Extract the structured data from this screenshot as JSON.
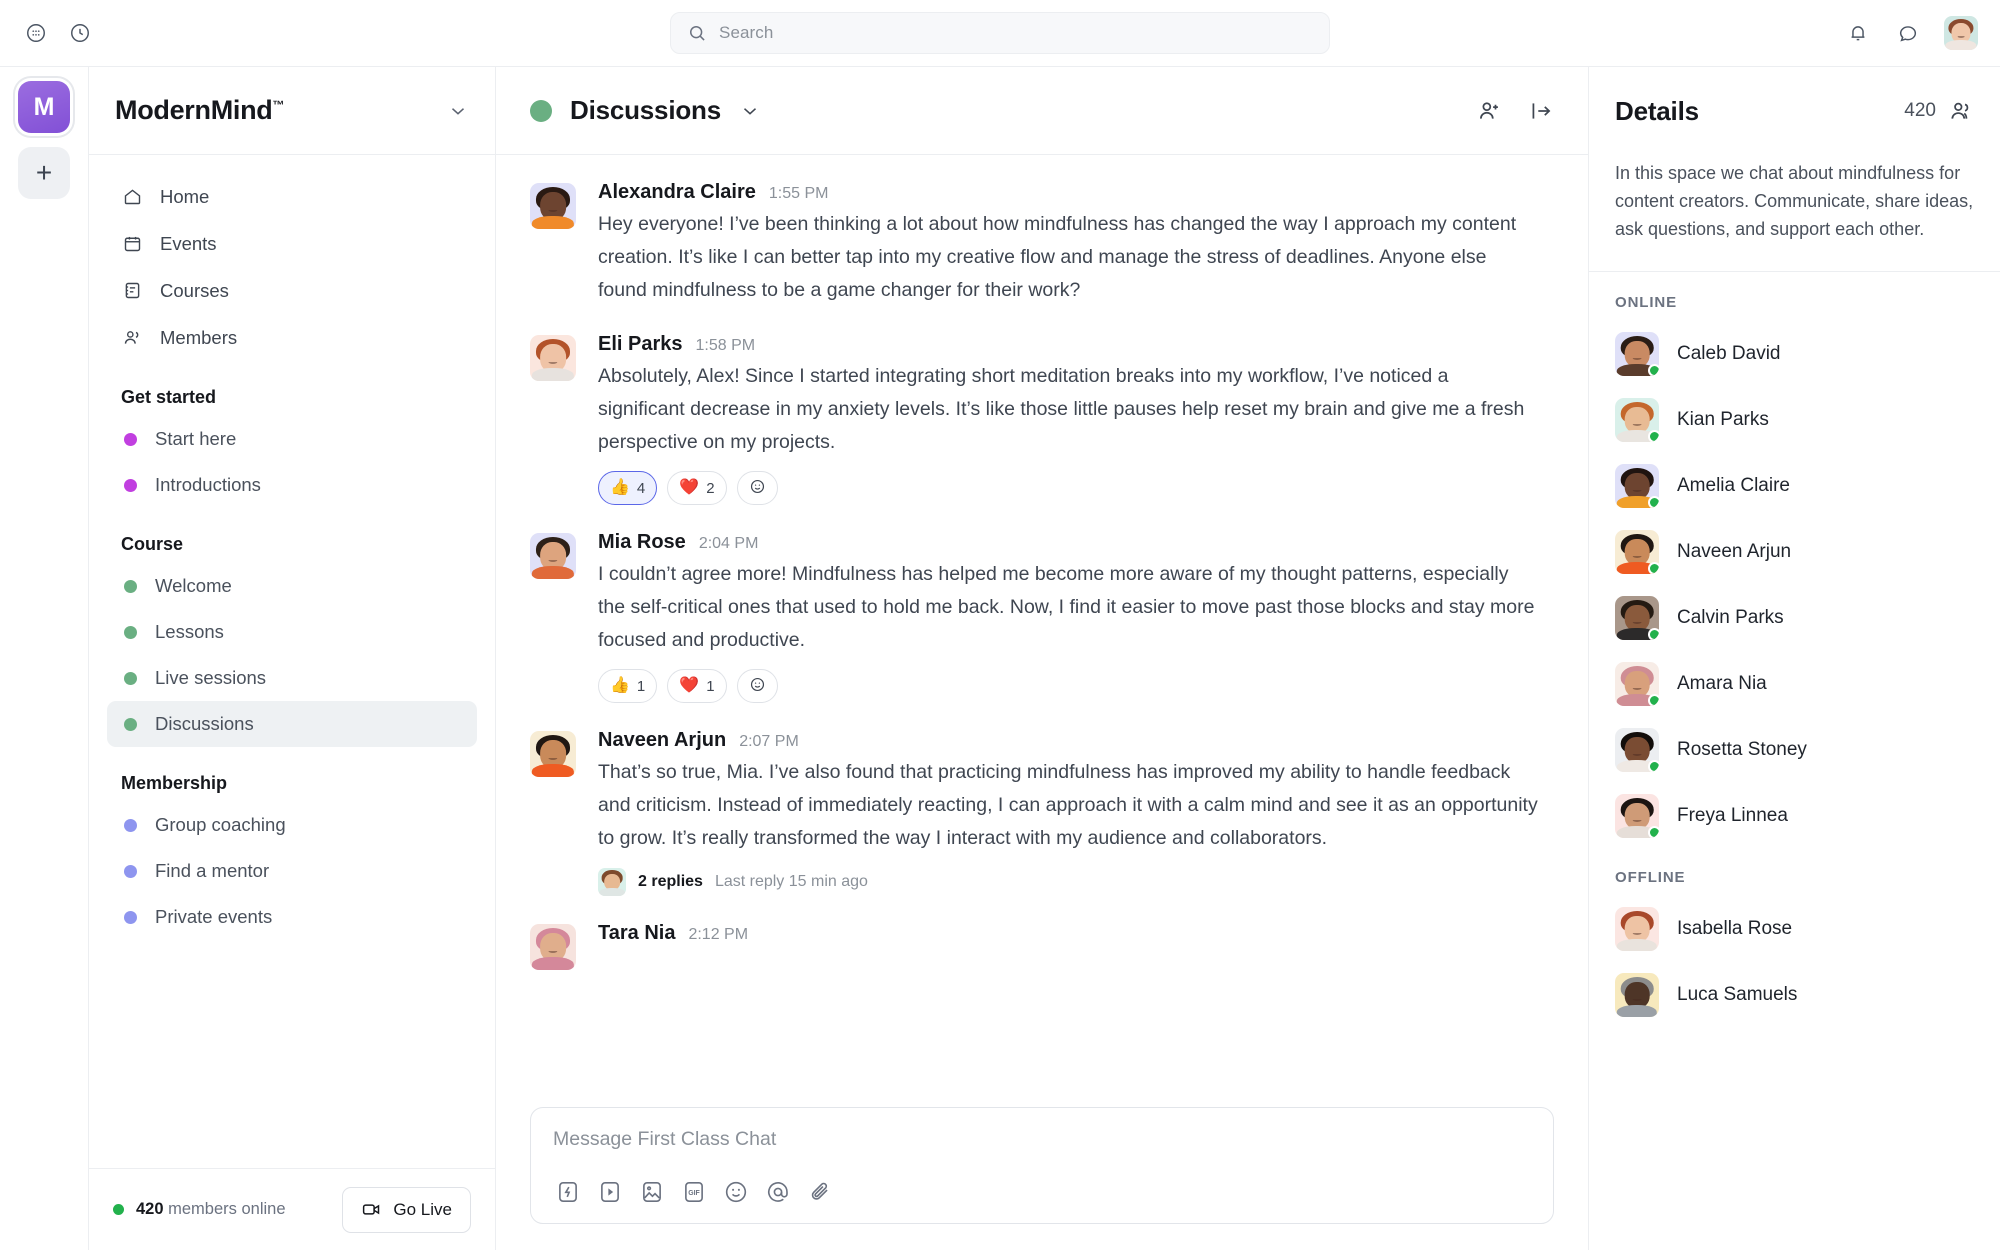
{
  "topbar": {
    "apps_icon": "grid-apps-icon",
    "history_icon": "clock-history-icon",
    "search": {
      "placeholder": "Search",
      "value": "",
      "icon": "search-icon"
    },
    "notifications_icon": "bell-icon",
    "messages_icon": "chat-bubble-icon",
    "account_avatar": "user-avatar"
  },
  "rail": {
    "workspace_initial": "M",
    "add_label": "+"
  },
  "sidebar": {
    "title": "ModernMind",
    "trademark": "™",
    "caret_icon": "chevron-down-icon",
    "nav": [
      {
        "label": "Home",
        "icon": "home-icon"
      },
      {
        "label": "Events",
        "icon": "calendar-icon"
      },
      {
        "label": "Courses",
        "icon": "course-list-icon"
      },
      {
        "label": "Members",
        "icon": "people-icon"
      }
    ],
    "groups": [
      {
        "title": "Get started",
        "items": [
          {
            "label": "Start here",
            "color": "#c13fe0",
            "active": false
          },
          {
            "label": "Introductions",
            "color": "#c13fe0",
            "active": false
          }
        ]
      },
      {
        "title": "Course",
        "items": [
          {
            "label": "Welcome",
            "color": "#6aaf82",
            "active": false
          },
          {
            "label": "Lessons",
            "color": "#6aaf82",
            "active": false
          },
          {
            "label": "Live sessions",
            "color": "#6aaf82",
            "active": false
          },
          {
            "label": "Discussions",
            "color": "#6aaf82",
            "active": true
          }
        ]
      },
      {
        "title": "Membership",
        "items": [
          {
            "label": "Group coaching",
            "color": "#8e95ef",
            "active": false
          },
          {
            "label": "Find a mentor",
            "color": "#8e95ef",
            "active": false
          },
          {
            "label": "Private events",
            "color": "#8e95ef",
            "active": false
          }
        ]
      }
    ],
    "footer": {
      "online_count": "420",
      "online_suffix": "members online",
      "go_live_label": "Go Live",
      "go_live_icon": "video-camera-icon"
    }
  },
  "chat": {
    "header": {
      "channel": "Discussions",
      "status_color": "#6aaf82",
      "caret_icon": "chevron-down-icon",
      "add_member_icon": "add-person-icon",
      "collapse_icon": "panel-collapse-icon"
    },
    "messages": [
      {
        "author": "Alexandra Claire",
        "time": "1:55 PM",
        "text": "Hey everyone! I’ve been thinking a lot about how mindfulness has changed the way I approach my content creation. It’s like I can better tap into my creative flow and manage the stress of deadlines. Anyone else found mindfulness to be a game changer for their work?",
        "avatar_bg": "#dfe0f8",
        "skin": "#6d4430",
        "hair": "#2a1a13",
        "shirt": "#f08a2a",
        "reactions": [],
        "thread": null
      },
      {
        "author": "Eli Parks",
        "time": "1:58 PM",
        "text": "Absolutely, Alex! Since I started integrating short meditation breaks into my workflow, I’ve noticed a significant decrease in my anxiety levels. It’s like those little pauses help reset my brain and give me a fresh perspective on my projects.",
        "avatar_bg": "#fbe6de",
        "skin": "#efc3a6",
        "hair": "#b3532a",
        "shirt": "#e7e2de",
        "reactions": [
          {
            "emoji": "👍",
            "count": "4",
            "selected": true
          },
          {
            "emoji": "❤️",
            "count": "2",
            "selected": false
          },
          {
            "emoji": "☺",
            "count": "",
            "selected": false
          }
        ],
        "thread": null
      },
      {
        "author": "Mia Rose",
        "time": "2:04 PM",
        "text": "I couldn’t agree more! Mindfulness has helped me become more aware of my thought patterns, especially the self-critical ones that used to hold me back. Now, I find it easier to move past those blocks and stay more focused and productive.",
        "avatar_bg": "#dfe0f8",
        "skin": "#dda47e",
        "hair": "#2d2018",
        "shirt": "#e06a3a",
        "reactions": [
          {
            "emoji": "👍",
            "count": "1",
            "selected": false
          },
          {
            "emoji": "❤️",
            "count": "1",
            "selected": false
          },
          {
            "emoji": "☺",
            "count": "",
            "selected": false
          }
        ],
        "thread": null
      },
      {
        "author": "Naveen Arjun",
        "time": "2:07 PM",
        "text": "That’s so true, Mia. I’ve also found that practicing mindfulness has improved my ability to handle feedback and criticism. Instead of immediately reacting, I can approach it with a calm mind and see it as an opportunity to grow. It’s really transformed the way I interact with my audience and collaborators.",
        "avatar_bg": "#f7ecd4",
        "skin": "#c98a5a",
        "hair": "#201712",
        "shirt": "#ef5b22",
        "reactions": [],
        "thread": {
          "count_label": "2 replies",
          "meta": "Last reply 15 min ago",
          "avatar_bg": "#d9f0ea",
          "skin": "#e7b992",
          "hair": "#7d4a2c"
        }
      },
      {
        "author": "Tara Nia",
        "time": "2:12 PM",
        "text": "",
        "avatar_bg": "#f6e3de",
        "skin": "#e0ae8c",
        "hair": "#d4889a",
        "shirt": "#d4889a",
        "reactions": [],
        "thread": null
      }
    ],
    "composer": {
      "placeholder": "Message First Class Chat",
      "value": "",
      "tools": [
        {
          "icon": "lightning-bolt-icon",
          "name": "quick-action"
        },
        {
          "icon": "video-play-icon",
          "name": "video"
        },
        {
          "icon": "image-icon",
          "name": "image"
        },
        {
          "icon": "gif-icon",
          "name": "gif",
          "text": "GIF"
        },
        {
          "icon": "emoji-smiley-icon",
          "name": "emoji"
        },
        {
          "icon": "mention-at-icon",
          "name": "mention"
        },
        {
          "icon": "paperclip-icon",
          "name": "attachment"
        }
      ]
    }
  },
  "details": {
    "title": "Details",
    "member_count": "420",
    "members_icon": "people-icon",
    "description": "In this space we chat about mindfulness for content creators. Communicate, share ideas, ask questions, and support each other.",
    "sections": [
      {
        "label": "ONLINE",
        "members": [
          {
            "name": "Caleb David",
            "avatar_bg": "#dfe0f8",
            "skin": "#c98a63",
            "hair": "#2b1d15",
            "shirt": "#5a3c2c",
            "online": true
          },
          {
            "name": "Kian Parks",
            "avatar_bg": "#d9f0ea",
            "skin": "#e8bb94",
            "hair": "#c4672c",
            "shirt": "#e9e5e0",
            "online": true
          },
          {
            "name": "Amelia Claire",
            "avatar_bg": "#dfe0f8",
            "skin": "#6d4430",
            "hair": "#201410",
            "shirt": "#f0a02a",
            "online": true
          },
          {
            "name": "Naveen Arjun",
            "avatar_bg": "#f7ecd4",
            "skin": "#c98a5a",
            "hair": "#201712",
            "shirt": "#ef5b22",
            "online": true
          },
          {
            "name": "Calvin Parks",
            "avatar_bg": "#a9978a",
            "skin": "#8a5a3c",
            "hair": "#241a12",
            "shirt": "#2c2a2a",
            "online": true
          },
          {
            "name": "Amara Nia",
            "avatar_bg": "#f7ece6",
            "skin": "#d8a07c",
            "hair": "#cf8d94",
            "shirt": "#cf8d94",
            "online": true
          },
          {
            "name": "Rosetta Stoney",
            "avatar_bg": "#eceef1",
            "skin": "#7a4c33",
            "hair": "#120d0a",
            "shirt": "#efe9e4",
            "online": true
          },
          {
            "name": "Freya Linnea",
            "avatar_bg": "#fbe4e2",
            "skin": "#cf9b77",
            "hair": "#1c1512",
            "shirt": "#e6ded8",
            "online": true
          }
        ]
      },
      {
        "label": "OFFLINE",
        "members": [
          {
            "name": "Isabella Rose",
            "avatar_bg": "#fbe6e2",
            "skin": "#eec3a4",
            "hair": "#a8482a",
            "shirt": "#e9e3dd",
            "online": false
          },
          {
            "name": "Luca Samuels",
            "avatar_bg": "#f7e9bd",
            "skin": "#4e3527",
            "hair": "#8c8c8c",
            "shirt": "#9aa0a6",
            "online": false
          }
        ]
      }
    ]
  },
  "colors": {
    "accent_purple": "#8250d6",
    "online_green": "#22b14c",
    "chip_selected_border": "#5b67e8",
    "chip_selected_bg": "#eef1fe"
  }
}
